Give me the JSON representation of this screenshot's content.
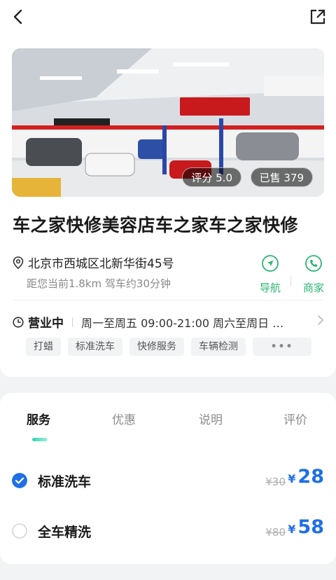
{
  "store": {
    "name": "车之家快修美容店车之家车之家快修",
    "rating_label": "评分 5.0",
    "sold_label": "已售 379",
    "address": "北京市西城区北新华街45号",
    "distance_text": "距您当前1.8km   驾车约30分钟",
    "hours_status": "营业中",
    "hours_text": "周一至周五 09:00-21:00  周六至周日 …",
    "tags": [
      "打蜡",
      "标准洗车",
      "快修服务",
      "车辆检测"
    ],
    "more_tags": "•••"
  },
  "actions": {
    "nav_label": "导航",
    "merchant_label": "商家"
  },
  "tabs": [
    "服务",
    "优惠",
    "说明",
    "评价"
  ],
  "services": [
    {
      "name": "标准洗车",
      "old_price": "¥30",
      "currency": "¥",
      "price": "28",
      "selected": true
    },
    {
      "name": "全车精洗",
      "old_price": "¥80",
      "currency": "¥",
      "price": "58",
      "selected": false
    }
  ],
  "colors": {
    "accent_green": "#2bb673",
    "price_blue": "#1f6fe5",
    "check_blue": "#1f6fe5",
    "tab_indicator": "#2fd3b4"
  },
  "icons": {
    "back": "chevron-left-icon",
    "share": "share-icon",
    "location": "location-pin-icon",
    "clock": "clock-icon",
    "navigate": "navigate-icon",
    "phone": "phone-icon"
  }
}
